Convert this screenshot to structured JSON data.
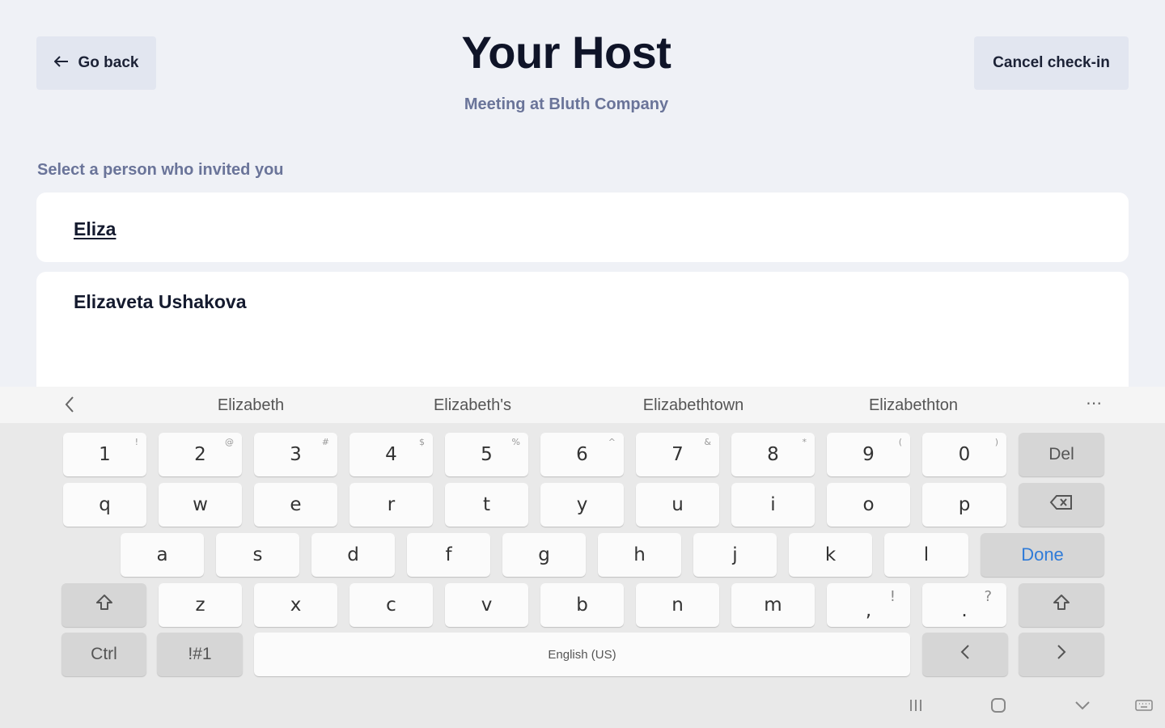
{
  "header": {
    "back_label": "Go back",
    "title": "Your Host",
    "subtitle": "Meeting at Bluth Company",
    "cancel_label": "Cancel check-in"
  },
  "form": {
    "prompt": "Select a person who invited you",
    "search_value": "Eliza",
    "results": [
      "Elizaveta Ushakova"
    ]
  },
  "keyboard": {
    "suggestions": [
      "Elizabeth",
      "Elizabeth's",
      "Elizabethtown",
      "Elizabethton"
    ],
    "number_row": [
      {
        "k": "1",
        "s": "!"
      },
      {
        "k": "2",
        "s": "@"
      },
      {
        "k": "3",
        "s": "#"
      },
      {
        "k": "4",
        "s": "$"
      },
      {
        "k": "5",
        "s": "%"
      },
      {
        "k": "6",
        "s": "^"
      },
      {
        "k": "7",
        "s": "&"
      },
      {
        "k": "8",
        "s": "*"
      },
      {
        "k": "9",
        "s": "("
      },
      {
        "k": "0",
        "s": ")"
      }
    ],
    "row_q": [
      "q",
      "w",
      "e",
      "r",
      "t",
      "y",
      "u",
      "i",
      "o",
      "p"
    ],
    "row_a": [
      "a",
      "s",
      "d",
      "f",
      "g",
      "h",
      "j",
      "k",
      "l"
    ],
    "row_z": [
      "z",
      "x",
      "c",
      "v",
      "b",
      "n",
      "m"
    ],
    "comma": {
      "k": ",",
      "s": "!"
    },
    "period": {
      "k": ".",
      "s": "?"
    },
    "del_label": "Del",
    "done_label": "Done",
    "ctrl_label": "Ctrl",
    "symbols_label": "!#1",
    "space_label": "English (US)",
    "colors": {
      "accent": "#2f7bd8",
      "key_bg": "#fbfbfb",
      "fn_key_bg": "#d6d6d6"
    }
  }
}
